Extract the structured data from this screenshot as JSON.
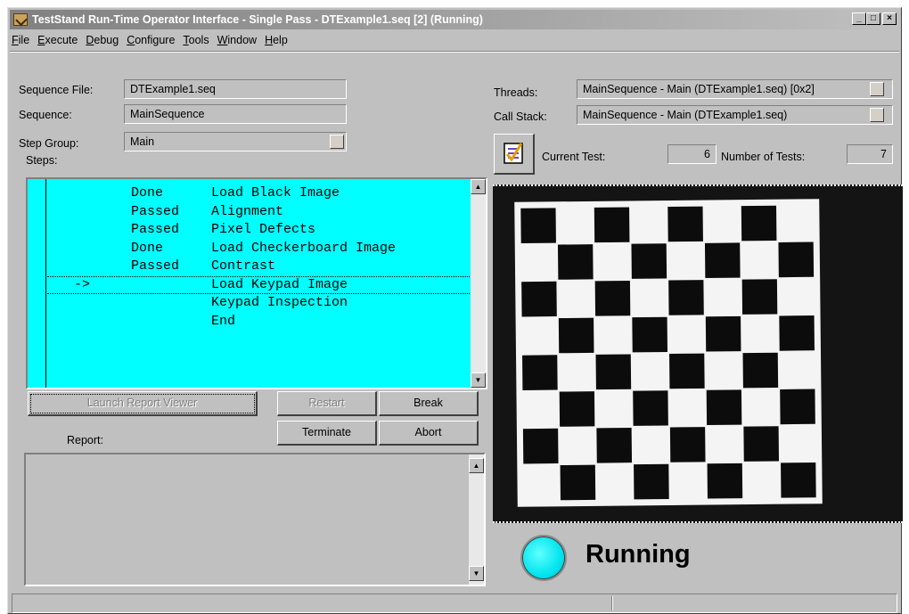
{
  "window": {
    "title": "TestStand Run-Time Operator Interface - Single Pass - DTExample1.seq [2] (Running)",
    "controls": {
      "minimize": "_",
      "maximize": "□",
      "close": "×"
    }
  },
  "menu": [
    "File",
    "Execute",
    "Debug",
    "Configure",
    "Tools",
    "Window",
    "Help"
  ],
  "labels": {
    "sequence_file": "Sequence File:",
    "sequence": "Sequence:",
    "step_group": "Step Group:",
    "steps": "Steps:",
    "threads": "Threads:",
    "call_stack": "Call Stack:",
    "current_test": "Current Test:",
    "number_of_tests": "Number of Tests:",
    "report": "Report:"
  },
  "values": {
    "sequence_file": "DTExample1.seq",
    "sequence": "MainSequence",
    "step_group": "Main",
    "threads": "MainSequence - Main (DTExample1.seq) [0x2]",
    "call_stack": "MainSequence - Main (DTExample1.seq)",
    "current_test": "6",
    "number_of_tests": "7"
  },
  "steps": [
    {
      "arrow": "",
      "status": "Done",
      "name": "Load Black Image"
    },
    {
      "arrow": "",
      "status": "Passed",
      "name": "Alignment"
    },
    {
      "arrow": "",
      "status": "Passed",
      "name": "Pixel Defects"
    },
    {
      "arrow": "",
      "status": "Done",
      "name": "Load Checkerboard Image"
    },
    {
      "arrow": "",
      "status": "Passed",
      "name": "Contrast"
    },
    {
      "arrow": "->",
      "status": "",
      "name": "Load Keypad Image"
    },
    {
      "arrow": "",
      "status": "",
      "name": "Keypad Inspection"
    },
    {
      "arrow": "",
      "status": "",
      "name": "End"
    }
  ],
  "current_step_index": 5,
  "buttons": {
    "launch_report_viewer": "Launch Report Viewer",
    "restart": "Restart",
    "break": "Break",
    "terminate": "Terminate",
    "abort": "Abort"
  },
  "status": {
    "text": "Running",
    "lamp_color": "#00e4ee"
  },
  "colors": {
    "steps_background": "#00ffff",
    "window_face": "#c0c0c0"
  },
  "icons": [
    "app-icon",
    "scroll-up-icon",
    "scroll-down-icon",
    "dropdown-button",
    "test-checklist-icon"
  ]
}
